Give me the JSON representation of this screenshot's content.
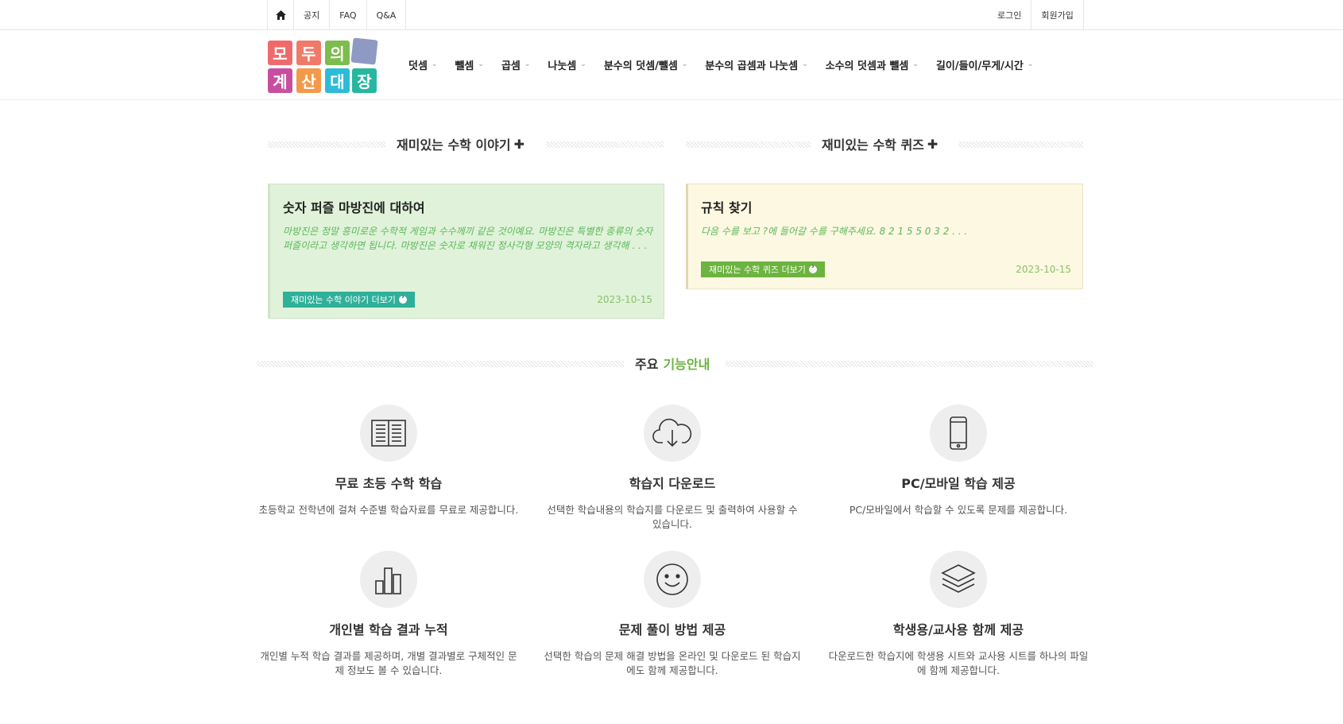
{
  "topbar": {
    "left": [
      "공지",
      "FAQ",
      "Q&A"
    ],
    "right": [
      "로그인",
      "회원가입"
    ]
  },
  "logo": {
    "chars": [
      "모",
      "두",
      "의",
      "계",
      "산",
      "대",
      "장"
    ],
    "colors": [
      "#ef6b6b",
      "#f07a6a",
      "#7dbd4f",
      "#c84fa0",
      "#f39a4a",
      "#2ebbd7",
      "#27b7a1"
    ],
    "accent_tile": "#8e9ac4"
  },
  "nav": [
    "덧셈",
    "뺄셈",
    "곱셈",
    "나눗셈",
    "분수의 덧셈/뺄셈",
    "분수의 곱셈과 나눗셈",
    "소수의 덧셈과 뺄셈",
    "길이/들이/무게/시간"
  ],
  "story": {
    "section_title": "재미있는 수학 이야기",
    "card_title": "숫자 퍼즐 마방진에 대하여",
    "excerpt": "마방진은 정말 흥미로운 수학적 게임과 수수께끼 같은 것이예요. 마방진은 특별한 종류의 숫자 퍼즐이라고 생각하면 됩니다. 마방진은 숫자로 채워진 정사각형 모양의 격자라고 생각해 . . .",
    "more_label": "재미있는 수학 이야기 더보기",
    "date": "2023-10-15",
    "color": "#2fb09a"
  },
  "quiz": {
    "section_title": "재미있는 수학 퀴즈",
    "card_title": "규칙 찾기",
    "excerpt": "다음 수를 보고 ?에 들어갈 수를 구해주세요. 8 2 1 5 5 0 3 2 . . .",
    "more_label": "재미있는 수학 퀴즈 더보기",
    "date": "2023-10-15",
    "color": "#6cb33f"
  },
  "features": {
    "title_prefix": "주요",
    "title_highlight": "기능안내",
    "highlight_color": "#6cb33f",
    "items": [
      {
        "icon": "book-icon",
        "title": "무료 초등 수학 학습",
        "desc": "초등학교 전학년에 걸쳐 수준별 학습자료를 무료로 제공합니다."
      },
      {
        "icon": "cloud-download-icon",
        "title": "학습지 다운로드",
        "desc": "선택한 학습내용의 학습지를 다운로드 및 출력하여 사용할 수 있습니다."
      },
      {
        "icon": "mobile-icon",
        "title": "PC/모바일 학습 제공",
        "desc": "PC/모바일에서 학습할 수 있도록 문제를 제공합니다."
      },
      {
        "icon": "bar-chart-icon",
        "title": "개인별 학습 결과 누적",
        "desc": "개인별 누적 학습 결과를 제공하며, 개별 결과별로 구체적인 문제 정보도 볼 수 있습니다."
      },
      {
        "icon": "smile-icon",
        "title": "문제 풀이 방법 제공",
        "desc": "선택한 학습의 문제 해결 방법을 온라인 및 다운로드 된 학습지에도 함께 제공합니다."
      },
      {
        "icon": "layers-icon",
        "title": "학생용/교사용 함께 제공",
        "desc": "다운로드한 학습지에 학생용 시트와 교사용 시트를 하나의 파일에 함께 제공합니다."
      }
    ]
  }
}
